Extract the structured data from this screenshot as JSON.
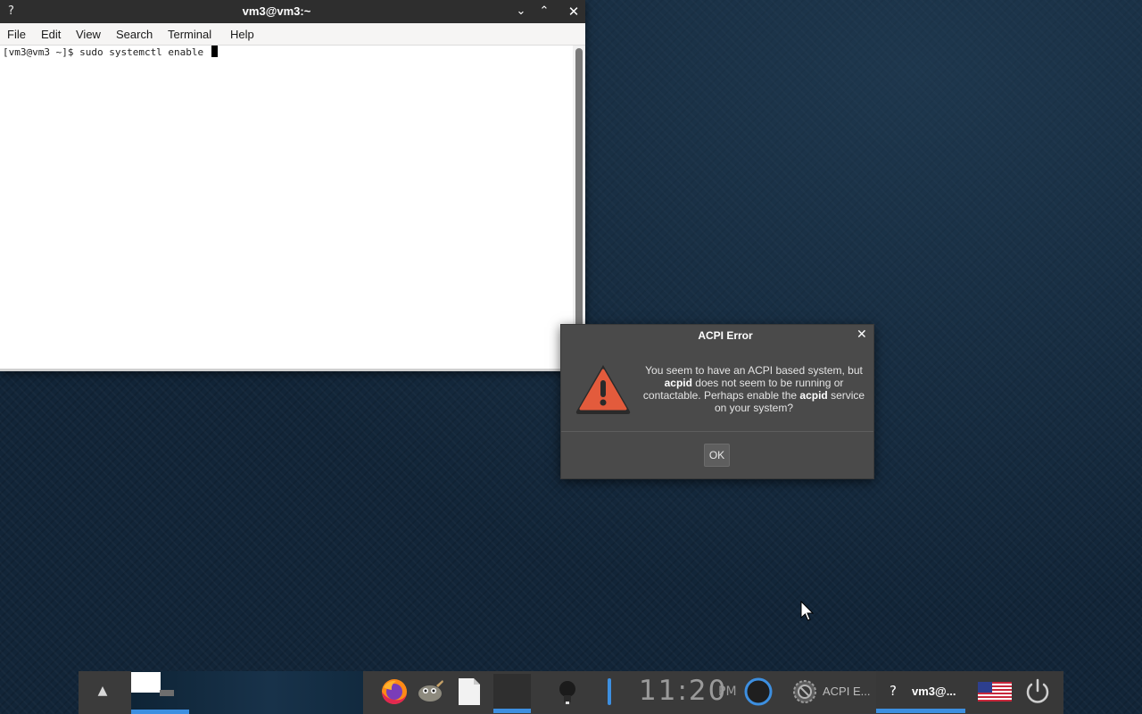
{
  "terminal": {
    "window_icon": "?",
    "title": "vm3@vm3:~",
    "controls": {
      "minimize": "⌄",
      "maximize": "⌃",
      "close": "✕"
    },
    "menu": [
      "File",
      "Edit",
      "View",
      "Search",
      "Terminal",
      "Help"
    ],
    "prompt_line": "[vm3@vm3 ~]$ sudo systemctl enable "
  },
  "dialog": {
    "title": "ACPI Error",
    "close": "✕",
    "message_parts": [
      "You seem to have an ACPI based system, but ",
      "acpid",
      " does not seem to be running or contactable. Perhaps enable the ",
      "acpid",
      " service on your system?"
    ],
    "ok_label": "OK",
    "icon": "warning-icon",
    "icon_color": "#e35b3c"
  },
  "taskbar": {
    "show_desktop_icon": "▲",
    "clock_time": "11:20",
    "clock_ampm": "PM",
    "tasks": [
      {
        "label": "ACPI E..."
      },
      {
        "icon_text": "?",
        "label": "vm3@..."
      }
    ],
    "accent_color": "#3d8fe0",
    "launchers": [
      "firefox-icon",
      "gimp-icon",
      "files-icon"
    ],
    "tray": [
      "bulb-icon",
      "volume-icon",
      "ring-icon",
      "gear-icon",
      "us-flag-icon",
      "power-icon"
    ]
  }
}
